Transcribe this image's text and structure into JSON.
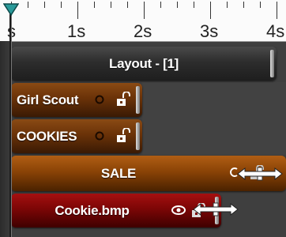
{
  "ruler": {
    "labels": [
      "s",
      "1s",
      "2s",
      "3s",
      "4s"
    ]
  },
  "tracks": [
    {
      "name": "Layout - [1]"
    },
    {
      "name": "Girl Scout"
    },
    {
      "name": "COOKIES"
    },
    {
      "name": "SALE"
    },
    {
      "name": "Cookie.bmp"
    }
  ],
  "colors": {
    "layout_track": "#2d2d2d",
    "text_track": "#6a3208",
    "sale_track": "#8a4306",
    "image_track": "#7c0606",
    "playhead_marker": "#2a9a9a"
  },
  "icons": [
    "playhead-marker-icon",
    "eye-icon",
    "unlock-icon",
    "resize-arrow-icon",
    "endcap-handle-icon"
  ]
}
